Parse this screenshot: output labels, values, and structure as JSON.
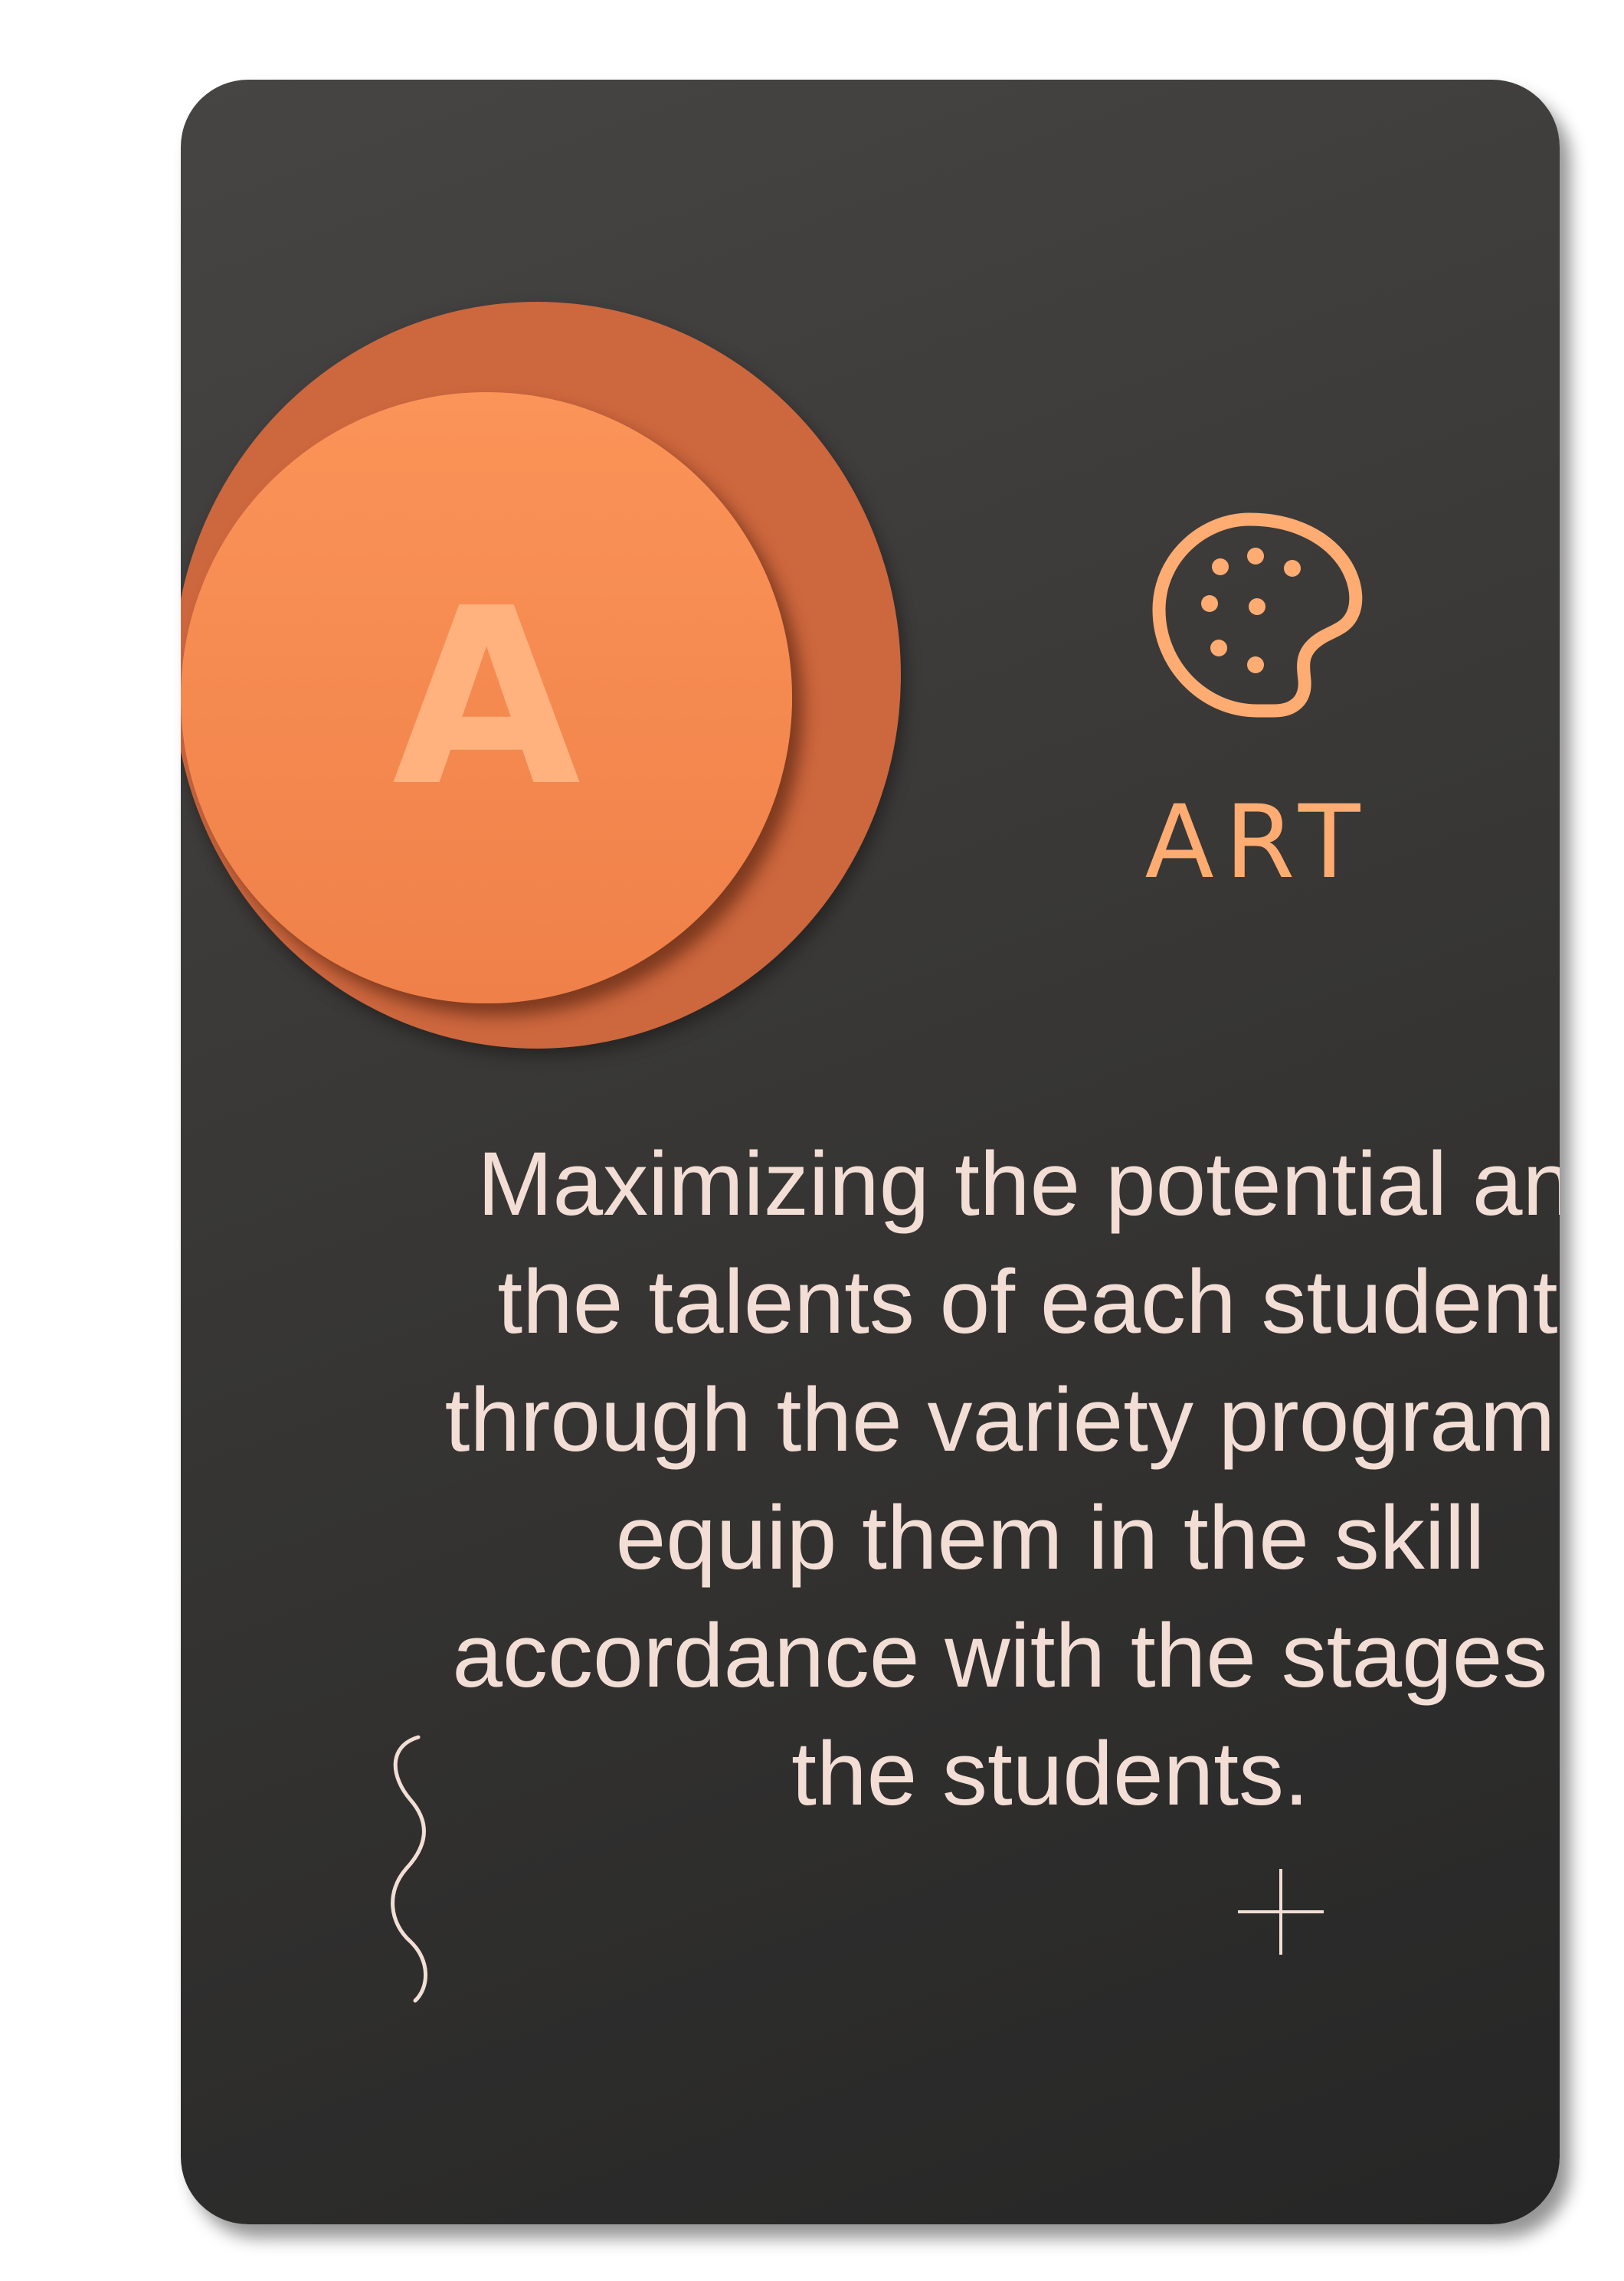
{
  "card": {
    "badge_letter": "A",
    "icon": "palette-icon",
    "title": "ART",
    "description": "Maximizing the potential and the talents of each students through the variety program to equip them in the skill accordance with the stages of the students."
  },
  "colors": {
    "card_background": "#3a3937",
    "accent_orange": "#ef8049",
    "accent_dark_orange": "#cd673e",
    "title_color": "#ffac72",
    "text_color": "#f3ded5",
    "decoration_color": "#f3ded5"
  },
  "decorations": [
    "squiggle-line",
    "plus-mark"
  ]
}
